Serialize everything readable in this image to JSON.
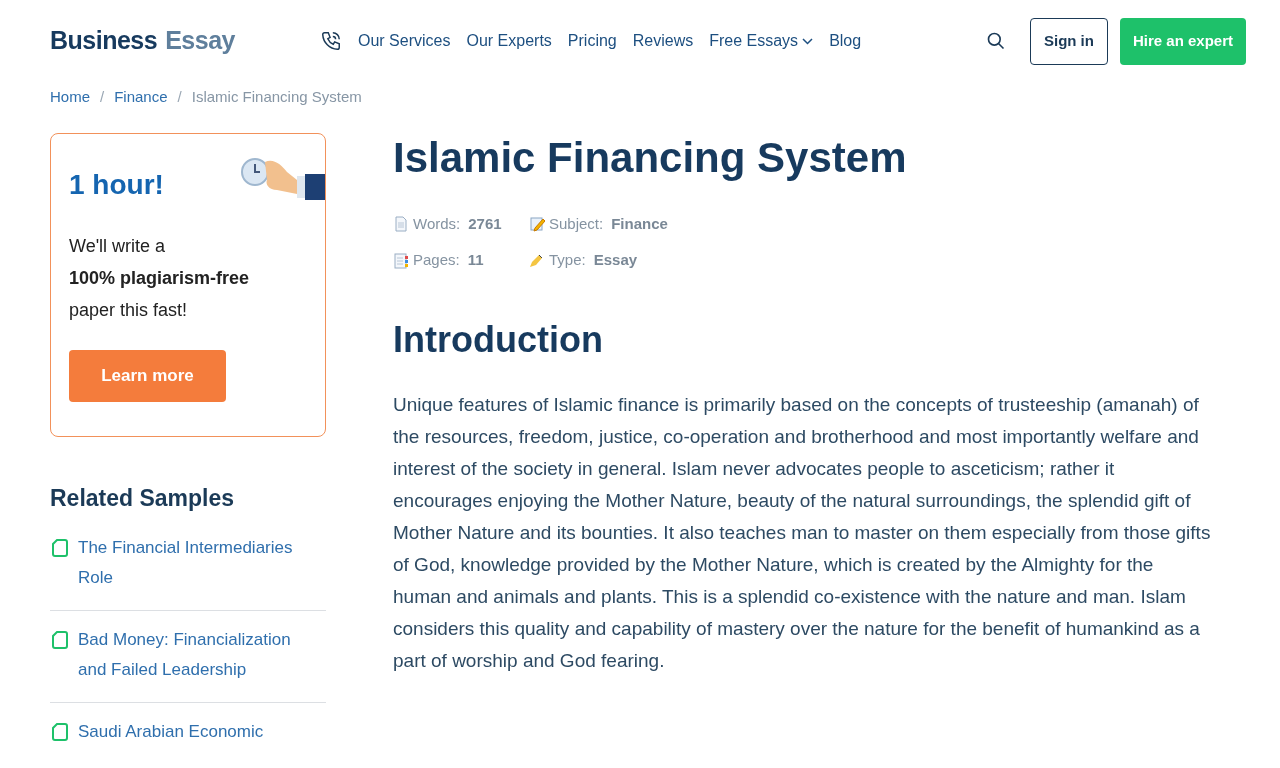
{
  "header": {
    "logo": [
      "Business",
      "Essay"
    ],
    "nav": [
      {
        "label": "Our Services",
        "dropdown": false
      },
      {
        "label": "Our Experts",
        "dropdown": false
      },
      {
        "label": "Pricing",
        "dropdown": false
      },
      {
        "label": "Reviews",
        "dropdown": false
      },
      {
        "label": "Free Essays",
        "dropdown": true
      },
      {
        "label": "Blog",
        "dropdown": false
      }
    ],
    "sign_in": "Sign in",
    "hire": "Hire an expert"
  },
  "breadcrumb": [
    {
      "label": "Home",
      "current": false
    },
    {
      "separator": "/",
      "label": "Finance",
      "current": false
    },
    {
      "separator": "/",
      "label": "Islamic Financing System",
      "current": true
    }
  ],
  "promo": {
    "title": "1 hour!",
    "text": "We'll write a **100% plagiarism-free** paper this fast!",
    "button": "Learn more"
  },
  "related": {
    "title": "Related Samples",
    "items": [
      "The Financial Intermediaries Role",
      "Bad Money: Financialization and Failed Leadership",
      "Saudi Arabian Economic"
    ]
  },
  "article": {
    "title": "Islamic Financing System",
    "meta": [
      {
        "kind": "words",
        "label": "Words:",
        "value": "2761"
      },
      {
        "kind": "subject",
        "label": "Subject:",
        "value": "Finance"
      },
      {
        "kind": "pages",
        "label": "Pages:",
        "value": "11"
      },
      {
        "kind": "type",
        "label": "Type:",
        "value": "Essay"
      }
    ],
    "heading": "Introduction",
    "paragraph": "Unique features of Islamic finance is primarily based on the concepts of trusteeship (amanah) of the resources, freedom, justice, co-operation and brotherhood and most importantly welfare and interest of the society in general. Islam never advocates people to asceticism; rather it encourages enjoying the Mother Nature, beauty of the natural surroundings, the splendid gift of Mother Nature and its bounties. It also teaches man to master on them especially from those gifts of God, knowledge provided by the Mother Nature, which is created by the Almighty for the human and animals and plants. This is a splendid co-existence with the nature and man. Islam considers this quality and capability of mastery over the nature for the benefit of humankind as a part of worship and God fearing."
  }
}
